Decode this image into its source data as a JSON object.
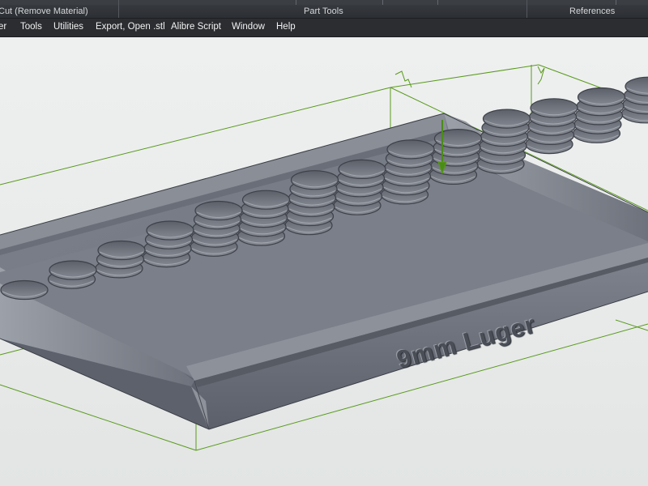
{
  "ribbon": {
    "groups": [
      {
        "label": "Cut (Remove Material)"
      },
      {
        "label": "Part Tools"
      },
      {
        "label": "References"
      }
    ]
  },
  "menubar": {
    "items": [
      {
        "label": "er"
      },
      {
        "label": "Tools"
      },
      {
        "label": "Utilities"
      },
      {
        "label": "Export, Open .stl"
      },
      {
        "label": "Alibre Script"
      },
      {
        "label": "Window"
      },
      {
        "label": "Help"
      }
    ]
  },
  "model": {
    "engraving_text": "9mm Luger",
    "colors": {
      "part_face": "#767b86",
      "part_dark": "#555963",
      "part_light": "#9ea2ab",
      "bounding_box": "#5a9a1a",
      "viewport_bg": "#eceeee"
    }
  }
}
